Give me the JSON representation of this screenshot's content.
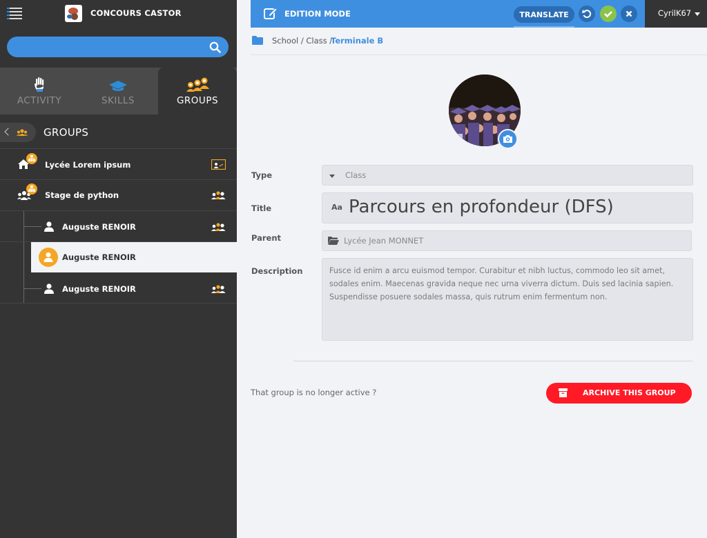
{
  "app": {
    "title": "CONCOURS CASTOR"
  },
  "sidebar": {
    "tabs": [
      {
        "label": "ACTIVITY",
        "icon": "hand-icon"
      },
      {
        "label": "SKILLS",
        "icon": "graduation-cap-icon"
      },
      {
        "label": "GROUPS",
        "icon": "people-group-icon"
      }
    ],
    "section_title": "GROUPS",
    "items": [
      {
        "label": "Lycée Lorem ipsum"
      },
      {
        "label": "Stage de python"
      },
      {
        "label": "Auguste RENOIR"
      },
      {
        "label": "Auguste RENOIR"
      },
      {
        "label": "Auguste RENOIR"
      }
    ]
  },
  "header": {
    "mode_label": "EDITION MODE",
    "translate_label": "TRANSLATE",
    "user": "CyrilK67"
  },
  "breadcrumb": {
    "path": "School / Class /",
    "current": "Terminale B"
  },
  "form": {
    "type_label": "Type",
    "type_value": "Class",
    "title_label": "Title",
    "title_prefix": "Aa",
    "title_value": "Parcours en profondeur (DFS)",
    "parent_label": "Parent",
    "parent_value": "Lycée Jean MONNET",
    "description_label": "Description",
    "description_value": "Fusce id enim a arcu euismod tempor. Curabitur et nibh luctus, commodo leo sit amet, sodales enim. Maecenas gravida neque nec urna viverra dictum. Duis sed lacinia sapien. Suspendisse posuere sodales massa, quis rutrum enim fermentum non."
  },
  "footer": {
    "inactive_text": "That group is no longer active ?",
    "archive_label": "ARCHIVE THIS GROUP"
  },
  "colors": {
    "accent": "#3f8fe0",
    "sidebar": "#343434",
    "badge": "#f5a623",
    "success": "#8bc34a",
    "danger": "#ff1a26"
  }
}
